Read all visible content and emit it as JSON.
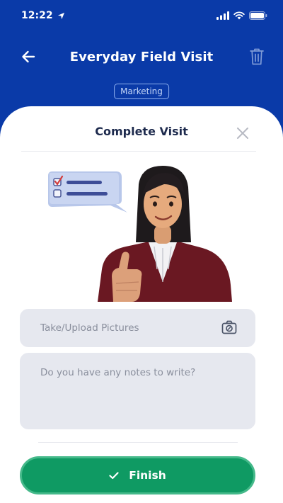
{
  "status_bar": {
    "time": "12:22",
    "icons": [
      "location-arrow-icon",
      "signal-icon",
      "wifi-icon",
      "battery-icon"
    ]
  },
  "header": {
    "title": "Everyday Field Visit",
    "tag": "Marketing",
    "icons": [
      "back-arrow-icon",
      "trash-icon"
    ]
  },
  "sheet": {
    "title": "Complete Visit",
    "upload_label": "Take/Upload Pictures",
    "notes_placeholder": "Do you have any notes to write?",
    "finish_label": "Finish"
  },
  "colors": {
    "brand_blue": "#0a3aa8",
    "finish_green": "#0f9a63",
    "field_bg": "#e6e8ef"
  }
}
